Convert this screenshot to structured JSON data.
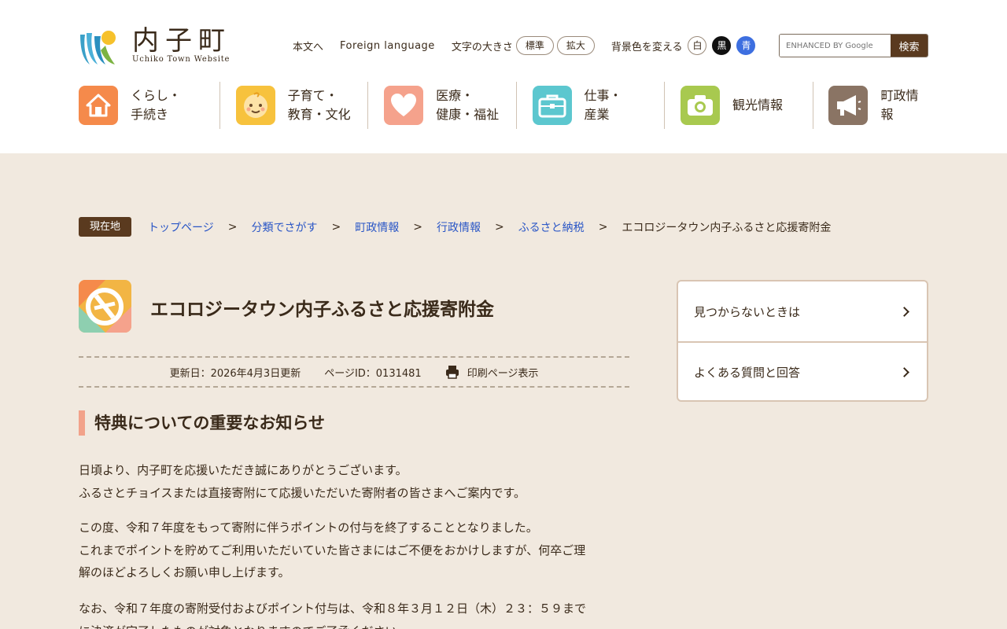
{
  "header": {
    "logo_title": "内子町",
    "logo_subtitle": "Uchiko Town Website",
    "skip_link": "本文へ",
    "foreign_language": "Foreign language",
    "font_size_label": "文字の大きさ",
    "font_standard": "標準",
    "font_large": "拡大",
    "bg_color_label": "背景色を変える",
    "bg_white": "白",
    "bg_black": "黒",
    "bg_blue": "青",
    "search_placeholder": "ENHANCED BY Google",
    "search_button": "検索"
  },
  "nav": [
    {
      "label": "くらし・\n手続き",
      "icon": "house-icon",
      "color": "#f58a4b"
    },
    {
      "label": "子育て・\n教育・文化",
      "icon": "baby-face-icon",
      "color": "#f7c23d"
    },
    {
      "label": "医療・\n健康・福祉",
      "icon": "heart-icon",
      "color": "#f5a28c"
    },
    {
      "label": "仕事・\n産業",
      "icon": "briefcase-icon",
      "color": "#5cc7cf"
    },
    {
      "label": "観光情報",
      "icon": "camera-icon",
      "color": "#a8c94f"
    },
    {
      "label": "町政情報",
      "icon": "megaphone-icon",
      "color": "#8a7464"
    }
  ],
  "breadcrumb": {
    "here_label": "現在地",
    "links": [
      "トップページ",
      "分類でさがす",
      "町政情報",
      "行政情報",
      "ふるさと納税"
    ],
    "separator": ">",
    "current": "エコロジータウン内子ふるさと応援寄附金"
  },
  "page": {
    "title": "エコロジータウン内子ふるさと応援寄附金",
    "updated": "更新日：2026年4月3日更新",
    "page_id": "ページID：0131481",
    "print": "印刷ページ表示",
    "section_heading": "特典についての重要なお知らせ",
    "paragraphs": [
      [
        "日頃より、内子町を応援いただき誠にありがとうございます。",
        "ふるさとチョイスまたは直接寄附にて応援いただいた寄附者の皆さまへご案内です。"
      ],
      [
        "この度、令和７年度をもって寄附に伴うポイントの付与を終了することとなりました。",
        "これまでポイントを貯めてご利用いただいていた皆さまにはご不便をおかけしますが、何卒ご理",
        "解のほどよろしくお願い申し上げます。"
      ],
      [
        "なお、令和７年度の寄附受付およびポイント付与は、令和８年３月１２日（木）２３：５９まで",
        "に決済が完了したものが対象となりますのでご了承ください。"
      ]
    ]
  },
  "sidebar": {
    "items": [
      "見つからないときは",
      "よくある質問と回答"
    ]
  }
}
